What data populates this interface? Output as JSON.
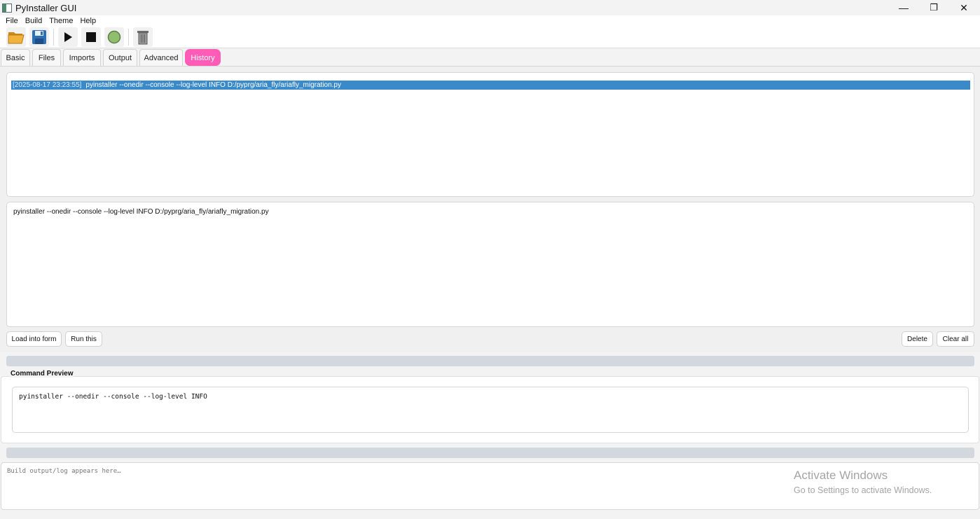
{
  "window": {
    "title": "PyInstaller GUI",
    "controls": {
      "minimize": "—",
      "restore": "❐",
      "close": "✕"
    }
  },
  "menu": [
    "File",
    "Build",
    "Theme",
    "Help"
  ],
  "toolbar": {
    "icons": [
      "open-folder-icon",
      "save-icon",
      "play-icon",
      "stop-icon",
      "status-circle-icon",
      "trash-icon"
    ]
  },
  "tabs": [
    "Basic",
    "Files",
    "Imports",
    "Output",
    "Advanced",
    "History"
  ],
  "active_tab": "History",
  "colors": {
    "accent": "#ff5cb8",
    "selection": "#3a8ac9"
  },
  "history": {
    "entries": [
      {
        "timestamp": "[2025-08-17 23:23:55]",
        "command": "pyinstaller --onedir --console --log-level INFO D:/pyprg/aria_fly/ariafly_migration.py"
      }
    ],
    "detail": "pyinstaller --onedir --console --log-level INFO D:/pyprg/aria_fly/ariafly_migration.py",
    "buttons": {
      "load": "Load into form",
      "run": "Run this",
      "delete": "Delete",
      "clear": "Clear all"
    }
  },
  "command_preview": {
    "label": "Command Preview",
    "text": "pyinstaller --onedir --console --log-level INFO"
  },
  "log": {
    "placeholder": "Build output/log appears here…"
  },
  "watermark": {
    "title": "Activate Windows",
    "subtitle": "Go to Settings to activate Windows."
  }
}
